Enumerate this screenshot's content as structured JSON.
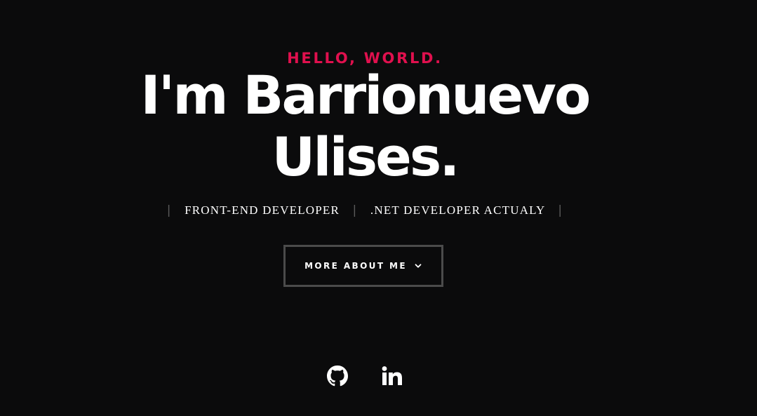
{
  "hero": {
    "greeting": "HELLO, WORLD.",
    "title_line1": "I'm Barrionuevo",
    "title_line2": "Ulises.",
    "roles": [
      "FRONT-END DEVELOPER",
      ".NET DEVELOPER ACTUALY"
    ],
    "separator": "|",
    "cta_label": "MORE ABOUT ME"
  },
  "socials": {
    "github_icon": "github-icon",
    "linkedin_icon": "linkedin-icon"
  },
  "colors": {
    "background": "#0b0b0c",
    "accent": "#e0104e",
    "text": "#ffffff",
    "muted": "#5b5b5b",
    "button_border": "#4b4b4b"
  }
}
